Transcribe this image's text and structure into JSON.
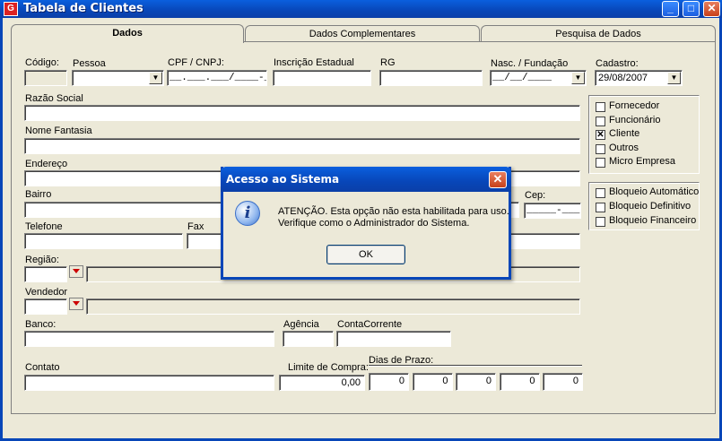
{
  "window": {
    "title": "Tabela de Clientes",
    "app_icon_glyph": "G",
    "minimize_glyph": "_",
    "maximize_glyph": "□",
    "close_glyph": "✕"
  },
  "tabs": [
    {
      "label": "Dados",
      "active": true
    },
    {
      "label": "Dados Complementares",
      "active": false
    },
    {
      "label": "Pesquisa de Dados",
      "active": false
    }
  ],
  "form": {
    "codigo_label": "Código:",
    "codigo_value": "",
    "pessoa_label": "Pessoa",
    "pessoa_value": "",
    "cpf_label": "CPF / CNPJ:",
    "cpf_mask": "__.___.___/____-__",
    "ie_label": "Inscrição Estadual",
    "ie_value": "",
    "rg_label": "RG",
    "rg_value": "",
    "nasc_label": "Nasc. / Fundação",
    "nasc_mask": "__/__/____",
    "cadastro_label": "Cadastro:",
    "cadastro_value": "29/08/2007",
    "razao_label": "Razão Social",
    "razao_value": "",
    "fantasia_label": "Nome Fantasia",
    "fantasia_value": "",
    "endereco_label": "Endereço",
    "endereco_value": "",
    "bairro_label": "Bairro",
    "bairro_value": "",
    "cep_label": "Cep:",
    "cep_mask": "_____-___",
    "telefone_label": "Telefone",
    "telefone_value": "",
    "fax_label": "Fax",
    "fax_value": "",
    "regiao_label": "Região:",
    "regiao_value": "",
    "vendedor_label": "Vendedor",
    "vendedor_value": "",
    "banco_label": "Banco:",
    "banco_value": "",
    "agencia_label": "Agência",
    "agencia_value": "",
    "conta_label": "ContaCorrente",
    "conta_value": "",
    "contato_label": "Contato",
    "contato_value": "",
    "limite_label": "Limite de Compra:",
    "limite_value": "0,00",
    "prazo_label": "Dias de Prazo:",
    "prazo_values": [
      "0",
      "0",
      "0",
      "0",
      "0"
    ]
  },
  "tipo_checkboxes": [
    {
      "label": "Fornecedor",
      "checked": false,
      "mark": ""
    },
    {
      "label": "Funcionário",
      "checked": false,
      "mark": ""
    },
    {
      "label": "Cliente",
      "checked": true,
      "mark": "✕"
    },
    {
      "label": "Outros",
      "checked": false,
      "mark": ""
    },
    {
      "label": "Micro Empresa",
      "checked": false,
      "mark": ""
    }
  ],
  "bloqueio_checkboxes": [
    {
      "label": "Bloqueio Automático",
      "checked": false,
      "mark": ""
    },
    {
      "label": "Bloqueio Definitivo",
      "checked": false,
      "mark": ""
    },
    {
      "label": "Bloqueio Financeiro",
      "checked": false,
      "mark": ""
    }
  ],
  "dialog": {
    "title": "Acesso ao Sistema",
    "icon_glyph": "i",
    "close_glyph": "✕",
    "message_line1": "ATENÇÃO. Esta opção não esta habilitada para uso.",
    "message_line2": "Verifique como o Administrador do Sistema.",
    "ok_label": "OK"
  },
  "colors": {
    "titlebar": "#0846b8",
    "face": "#ece9d8",
    "close_button": "#c8401a",
    "dropdown_arrow_red": "#cc0000"
  }
}
